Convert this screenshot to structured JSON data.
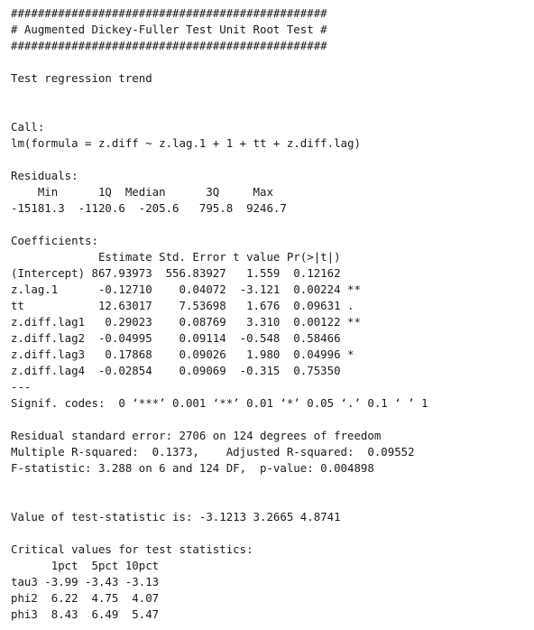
{
  "header": {
    "rule_top": "###############################################",
    "title": "# Augmented Dickey-Fuller Test Unit Root Test #",
    "rule_bottom": "###############################################"
  },
  "test_regression": "Test regression trend",
  "call": {
    "label": "Call:",
    "formula": "lm(formula = z.diff ~ z.lag.1 + 1 + tt + z.diff.lag)"
  },
  "residuals": {
    "label": "Residuals:",
    "header": "    Min      1Q  Median      3Q     Max ",
    "values": "-15181.3  -1120.6  -205.6   795.8  9246.7 "
  },
  "coefficients": {
    "label": "Coefficients:",
    "header": "             Estimate Std. Error t value Pr(>|t|)   ",
    "rows": [
      "(Intercept) 867.93973  556.83927   1.559  0.12162   ",
      "z.lag.1      -0.12710    0.04072  -3.121  0.00224 **",
      "tt           12.63017    7.53698   1.676  0.09631 . ",
      "z.diff.lag1   0.29023    0.08769   3.310  0.00122 **",
      "z.diff.lag2  -0.04995    0.09114  -0.548  0.58466   ",
      "z.diff.lag3   0.17868    0.09026   1.980  0.04996 * ",
      "z.diff.lag4  -0.02854    0.09069  -0.315  0.75350   "
    ],
    "separator": "---",
    "signif_codes": "Signif. codes:  0 ‘***’ 0.001 ‘**’ 0.01 ‘*’ 0.05 ‘.’ 0.1 ‘ ’ 1"
  },
  "summary": {
    "residual_se": "Residual standard error: 2706 on 124 degrees of freedom",
    "r_squared": "Multiple R-squared:  0.1373,    Adjusted R-squared:  0.09552 ",
    "f_statistic": "F-statistic: 3.288 on 6 and 124 DF,  p-value: 0.004898"
  },
  "test_statistic": "Value of test-statistic is: -3.1213 3.2665 4.8741 ",
  "critical_values": {
    "label": "Critical values for test statistics: ",
    "header": "      1pct  5pct 10pct",
    "rows": [
      "tau3 -3.99 -3.43 -3.13",
      "phi2  6.22  4.75  4.07",
      "phi3  8.43  6.49  5.47"
    ]
  }
}
